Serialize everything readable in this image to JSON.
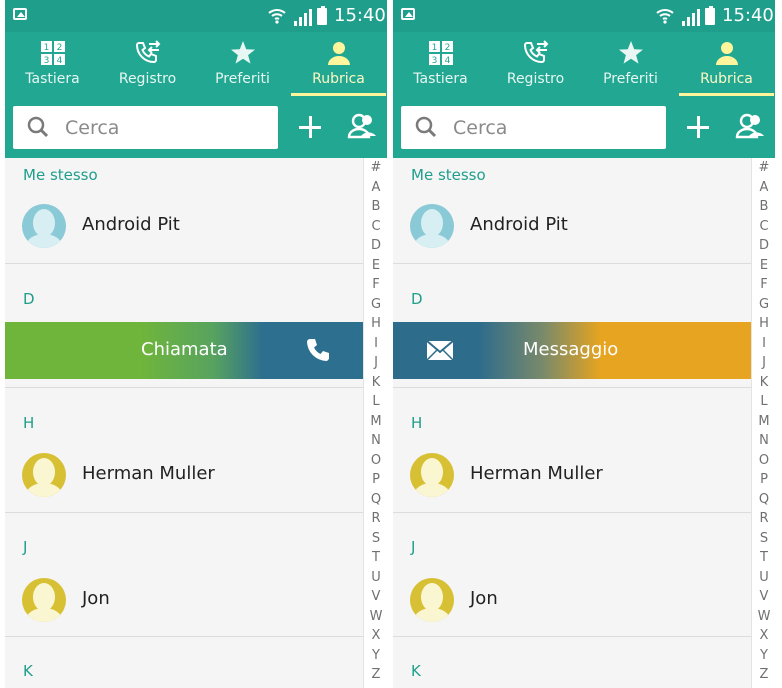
{
  "status": {
    "time": "15:40"
  },
  "tabs": [
    {
      "label": "Tastiera",
      "icon": "dialpad-icon"
    },
    {
      "label": "Registro",
      "icon": "call-log-icon"
    },
    {
      "label": "Preferiti",
      "icon": "star-icon"
    },
    {
      "label": "Rubrica",
      "icon": "person-icon",
      "active": true
    }
  ],
  "search": {
    "placeholder": "Cerca"
  },
  "sections": {
    "me": "Me stesso",
    "d": "D",
    "h": "H",
    "j": "J",
    "k": "K"
  },
  "contacts": {
    "me": "Android Pit",
    "herman": "Herman Muller",
    "jon": "Jon"
  },
  "actions": {
    "call": "Chiamata",
    "message": "Messaggio"
  },
  "index": [
    "#",
    "A",
    "B",
    "C",
    "D",
    "E",
    "F",
    "G",
    "H",
    "I",
    "J",
    "K",
    "L",
    "M",
    "N",
    "O",
    "P",
    "Q",
    "R",
    "S",
    "T",
    "U",
    "V",
    "W",
    "X",
    "Y",
    "Z"
  ],
  "colors": {
    "primary": "#22a892",
    "accent_tab": "#fff59d",
    "call": "#6fb53b",
    "message": "#e6a420",
    "action_blue": "#2d6f8e"
  }
}
